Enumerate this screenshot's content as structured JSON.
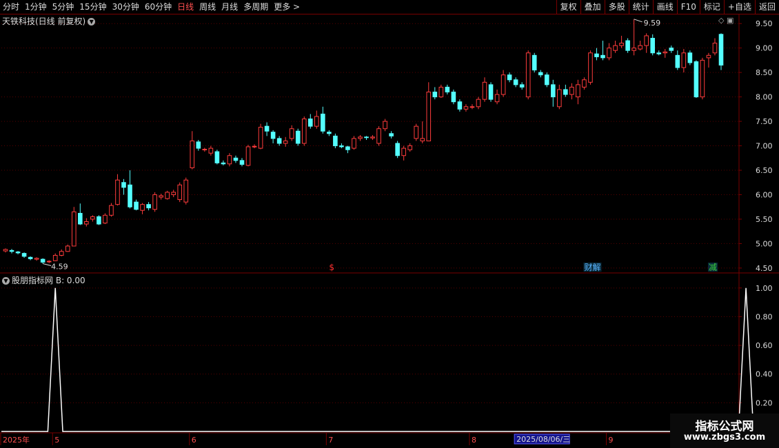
{
  "toolbar": {
    "periods": [
      "分时",
      "1分钟",
      "5分钟",
      "15分钟",
      "30分钟",
      "60分钟",
      "日线",
      "周线",
      "月线",
      "多周期",
      "更多 >"
    ],
    "active_period": "日线",
    "buttons": [
      "复权",
      "叠加",
      "多股",
      "统计",
      "画线",
      "F10",
      "标记",
      "+自选",
      "返回"
    ]
  },
  "main_chart": {
    "title": "天铁科技(日线 前复权)",
    "high_label": "9.59",
    "low_label": "4.59",
    "price_ticks": [
      "9.50",
      "9.00",
      "8.50",
      "8.00",
      "7.50",
      "7.00",
      "6.50",
      "6.00",
      "5.50",
      "5.00",
      "4.50"
    ],
    "markers": [
      {
        "text": "$",
        "color": "#ff3030"
      },
      {
        "text": "财解",
        "color": "#5ab4ff"
      },
      {
        "text": "减",
        "color": "#3ad23a"
      }
    ],
    "colors": {
      "up": "#ff3c3c",
      "down": "#54ffff",
      "grid": "#5a0000",
      "axis": "#7a0000"
    }
  },
  "sub_chart": {
    "name": "股朋指标网",
    "label": "B: 0.00",
    "ticks": [
      "1.00",
      "0.80",
      "0.60",
      "0.40",
      "0.20"
    ]
  },
  "x_axis": {
    "labels": [
      "2025年",
      "5",
      "6",
      "7",
      "8",
      "9"
    ],
    "cursor_label": "2025/08/06/三"
  },
  "watermark": {
    "cn": "指标公式网",
    "url": "www.zbgs3.com"
  },
  "chart_data": {
    "type": "candlestick",
    "ylim": [
      4.4,
      9.7
    ],
    "candles": [
      [
        4.85,
        4.88,
        4.82,
        4.9
      ],
      [
        4.86,
        4.84,
        4.8,
        4.89
      ],
      [
        4.83,
        4.81,
        4.78,
        4.85
      ],
      [
        4.8,
        4.74,
        4.71,
        4.82
      ],
      [
        4.72,
        4.69,
        4.66,
        4.74
      ],
      [
        4.68,
        4.7,
        4.65,
        4.72
      ],
      [
        4.68,
        4.62,
        4.59,
        4.7
      ],
      [
        4.63,
        4.64,
        4.6,
        4.66
      ],
      [
        4.65,
        4.76,
        4.64,
        4.8
      ],
      [
        4.76,
        4.84,
        4.74,
        4.88
      ],
      [
        4.84,
        4.95,
        4.83,
        4.98
      ],
      [
        4.95,
        5.65,
        4.95,
        5.75
      ],
      [
        5.62,
        5.4,
        5.38,
        5.82
      ],
      [
        5.4,
        5.45,
        5.35,
        5.52
      ],
      [
        5.5,
        5.55,
        5.45,
        5.58
      ],
      [
        5.55,
        5.4,
        5.38,
        5.58
      ],
      [
        5.42,
        5.58,
        5.4,
        5.62
      ],
      [
        5.58,
        5.78,
        5.55,
        5.83
      ],
      [
        5.8,
        6.3,
        5.78,
        6.42
      ],
      [
        6.25,
        6.15,
        6.0,
        6.32
      ],
      [
        6.2,
        5.75,
        5.72,
        6.5
      ],
      [
        5.85,
        5.7,
        5.68,
        5.9
      ],
      [
        5.68,
        5.8,
        5.6,
        5.83
      ],
      [
        5.8,
        5.73,
        5.68,
        5.85
      ],
      [
        5.7,
        6.0,
        5.65,
        6.05
      ],
      [
        5.95,
        5.98,
        5.9,
        6.02
      ],
      [
        5.92,
        6.05,
        5.9,
        6.08
      ],
      [
        6.0,
        6.05,
        5.95,
        6.1
      ],
      [
        5.9,
        6.2,
        5.85,
        6.25
      ],
      [
        5.85,
        6.3,
        5.8,
        6.35
      ],
      [
        6.55,
        7.1,
        6.52,
        7.3
      ],
      [
        7.08,
        6.95,
        6.9,
        7.12
      ],
      [
        6.92,
        6.93,
        6.88,
        6.96
      ],
      [
        6.85,
        6.95,
        6.8,
        7.0
      ],
      [
        6.88,
        6.65,
        6.62,
        6.92
      ],
      [
        6.65,
        6.63,
        6.6,
        6.7
      ],
      [
        6.63,
        6.8,
        6.58,
        6.85
      ],
      [
        6.75,
        6.7,
        6.65,
        6.8
      ],
      [
        6.7,
        6.62,
        6.58,
        6.75
      ],
      [
        6.6,
        6.98,
        6.58,
        7.02
      ],
      [
        6.98,
        6.99,
        6.95,
        7.03
      ],
      [
        6.95,
        7.38,
        6.93,
        7.45
      ],
      [
        7.4,
        7.3,
        7.2,
        7.48
      ],
      [
        7.28,
        7.15,
        7.05,
        7.32
      ],
      [
        7.15,
        7.05,
        7.0,
        7.2
      ],
      [
        7.05,
        7.1,
        6.98,
        7.18
      ],
      [
        7.15,
        7.35,
        7.1,
        7.42
      ],
      [
        7.3,
        7.05,
        7.0,
        7.35
      ],
      [
        7.05,
        7.55,
        7.0,
        7.6
      ],
      [
        7.55,
        7.4,
        7.35,
        7.65
      ],
      [
        7.4,
        7.6,
        7.35,
        7.72
      ],
      [
        7.65,
        7.3,
        7.25,
        7.8
      ],
      [
        7.28,
        7.25,
        7.2,
        7.32
      ],
      [
        7.2,
        7.0,
        6.95,
        7.25
      ],
      [
        7.0,
        6.98,
        6.95,
        7.05
      ],
      [
        6.98,
        6.92,
        6.85,
        7.0
      ],
      [
        6.95,
        7.15,
        6.92,
        7.2
      ],
      [
        7.15,
        7.18,
        7.1,
        7.22
      ],
      [
        7.18,
        7.17,
        7.12,
        7.2
      ],
      [
        7.16,
        7.18,
        7.12,
        7.22
      ],
      [
        7.05,
        7.35,
        7.0,
        7.4
      ],
      [
        7.35,
        7.5,
        7.3,
        7.55
      ],
      [
        7.25,
        7.2,
        7.15,
        7.3
      ],
      [
        7.05,
        6.8,
        6.75,
        7.1
      ],
      [
        6.8,
        6.95,
        6.7,
        7.0
      ],
      [
        6.92,
        7.0,
        6.88,
        7.05
      ],
      [
        7.15,
        7.4,
        7.1,
        7.45
      ],
      [
        7.1,
        7.15,
        7.05,
        7.5
      ],
      [
        7.1,
        8.1,
        7.1,
        8.3
      ],
      [
        8.1,
        8.0,
        7.95,
        8.2
      ],
      [
        8.0,
        8.2,
        7.98,
        8.25
      ],
      [
        8.2,
        8.1,
        8.05,
        8.25
      ],
      [
        8.1,
        7.9,
        7.85,
        8.15
      ],
      [
        7.9,
        7.75,
        7.7,
        7.95
      ],
      [
        7.75,
        7.8,
        7.7,
        7.85
      ],
      [
        7.8,
        7.8,
        7.75,
        7.85
      ],
      [
        7.8,
        7.95,
        7.75,
        8.0
      ],
      [
        7.95,
        8.3,
        7.9,
        8.4
      ],
      [
        8.25,
        7.95,
        7.9,
        8.3
      ],
      [
        7.9,
        8.05,
        7.85,
        8.15
      ],
      [
        8.05,
        8.45,
        8.0,
        8.55
      ],
      [
        8.45,
        8.35,
        8.3,
        8.5
      ],
      [
        8.35,
        8.25,
        8.2,
        8.4
      ],
      [
        8.25,
        8.2,
        8.15,
        8.3
      ],
      [
        8.0,
        8.9,
        7.95,
        8.95
      ],
      [
        8.85,
        8.55,
        8.5,
        8.9
      ],
      [
        8.5,
        8.45,
        8.4,
        8.55
      ],
      [
        8.45,
        8.25,
        8.2,
        8.5
      ],
      [
        8.25,
        8.0,
        7.8,
        8.35
      ],
      [
        7.8,
        8.15,
        7.75,
        8.25
      ],
      [
        8.15,
        8.05,
        8.0,
        8.25
      ],
      [
        8.05,
        8.2,
        7.95,
        8.28
      ],
      [
        8.0,
        8.25,
        7.85,
        8.35
      ],
      [
        8.2,
        8.35,
        8.15,
        8.4
      ],
      [
        8.3,
        8.9,
        8.25,
        8.95
      ],
      [
        8.88,
        8.82,
        8.75,
        9.0
      ],
      [
        8.85,
        8.8,
        8.75,
        9.15
      ],
      [
        8.8,
        9.0,
        8.75,
        9.1
      ],
      [
        8.95,
        9.05,
        8.9,
        9.15
      ],
      [
        9.05,
        9.1,
        9.0,
        9.25
      ],
      [
        9.15,
        8.95,
        8.9,
        9.2
      ],
      [
        8.95,
        9.0,
        8.85,
        9.59
      ],
      [
        8.98,
        9.05,
        8.95,
        9.15
      ],
      [
        9.05,
        9.25,
        8.9,
        9.3
      ],
      [
        9.2,
        8.9,
        8.85,
        9.28
      ],
      [
        8.9,
        8.88,
        8.85,
        8.95
      ],
      [
        8.9,
        8.92,
        8.8,
        8.98
      ],
      [
        9.0,
        8.95,
        8.9,
        9.05
      ],
      [
        8.85,
        8.6,
        8.55,
        8.95
      ],
      [
        8.6,
        8.9,
        8.5,
        8.98
      ],
      [
        8.9,
        8.7,
        8.65,
        8.95
      ],
      [
        8.72,
        8.0,
        7.98,
        8.75
      ],
      [
        8.0,
        8.75,
        7.95,
        8.8
      ],
      [
        8.8,
        8.85,
        8.6,
        8.9
      ],
      [
        8.9,
        9.1,
        8.85,
        9.2
      ],
      [
        9.28,
        8.65,
        8.55,
        9.3
      ]
    ],
    "indicator": {
      "name": "B",
      "spikes": [
        {
          "index": 8,
          "value": 1.0
        },
        {
          "index": 119,
          "value": 1.0
        }
      ],
      "ylim": [
        0,
        1.1
      ]
    }
  }
}
